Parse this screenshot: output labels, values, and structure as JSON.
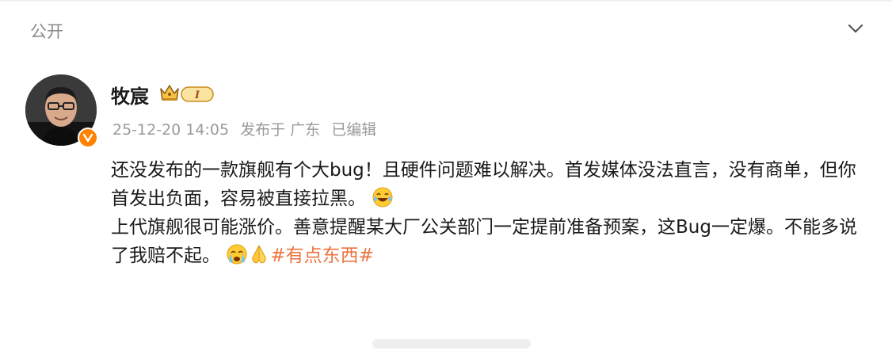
{
  "header": {
    "visibility_label": "公开",
    "collapse_icon": "chevron-down-icon"
  },
  "post": {
    "author": {
      "name": "牧宸",
      "avatar_icon": "avatar",
      "verified_icon": "verified-v-icon",
      "crown_icon": "crown-icon",
      "level_badge": "I"
    },
    "meta": {
      "timestamp": "25-12-20 14:05",
      "published_at": "发布于 广东",
      "edited": "已编辑"
    },
    "content": {
      "line1_part1": "还没发布的一款旗舰有个大bug！且硬件问题难以解决。首发媒体没法直言，没有商单，但你首发出负面，容易被直接拉黑。",
      "line2_part1": "上代旗舰很可能涨价。善意提醒某大厂公关部门一定提前准备预案，这Bug一定爆。不能多说了我赔不起。",
      "hashtag": "#有点东西#"
    }
  },
  "colors": {
    "accent_orange": "#ff8200",
    "hashtag": "#eb7340",
    "meta_gray": "#9a9a9a"
  }
}
